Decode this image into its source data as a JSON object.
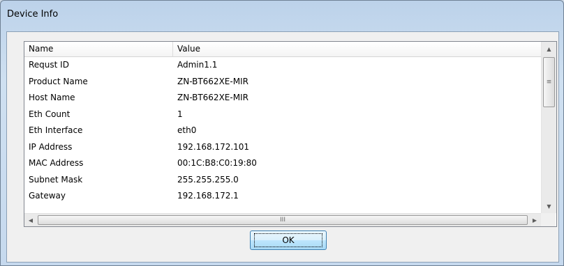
{
  "window": {
    "title": "Device Info"
  },
  "list": {
    "columns": [
      "Name",
      "Value"
    ],
    "rows": [
      {
        "name": "Requst ID",
        "value": "Admin1.1"
      },
      {
        "name": "Product Name",
        "value": "ZN-BT662XE-MIR"
      },
      {
        "name": "Host Name",
        "value": "ZN-BT662XE-MIR"
      },
      {
        "name": "Eth Count",
        "value": "1"
      },
      {
        "name": "Eth Interface",
        "value": "eth0"
      },
      {
        "name": "IP Address",
        "value": "192.168.172.101"
      },
      {
        "name": "MAC Address",
        "value": "00:1C:B8:C0:19:80"
      },
      {
        "name": "Subnet Mask",
        "value": "255.255.255.0"
      },
      {
        "name": "Gateway",
        "value": "192.168.172.1"
      }
    ]
  },
  "scrollbars": {
    "up_arrow": "▲",
    "down_arrow": "▼",
    "left_arrow": "◀",
    "right_arrow": "▶",
    "vertical_grip": "≡",
    "horizontal_grip": "III"
  },
  "buttons": {
    "ok_label": "OK"
  }
}
